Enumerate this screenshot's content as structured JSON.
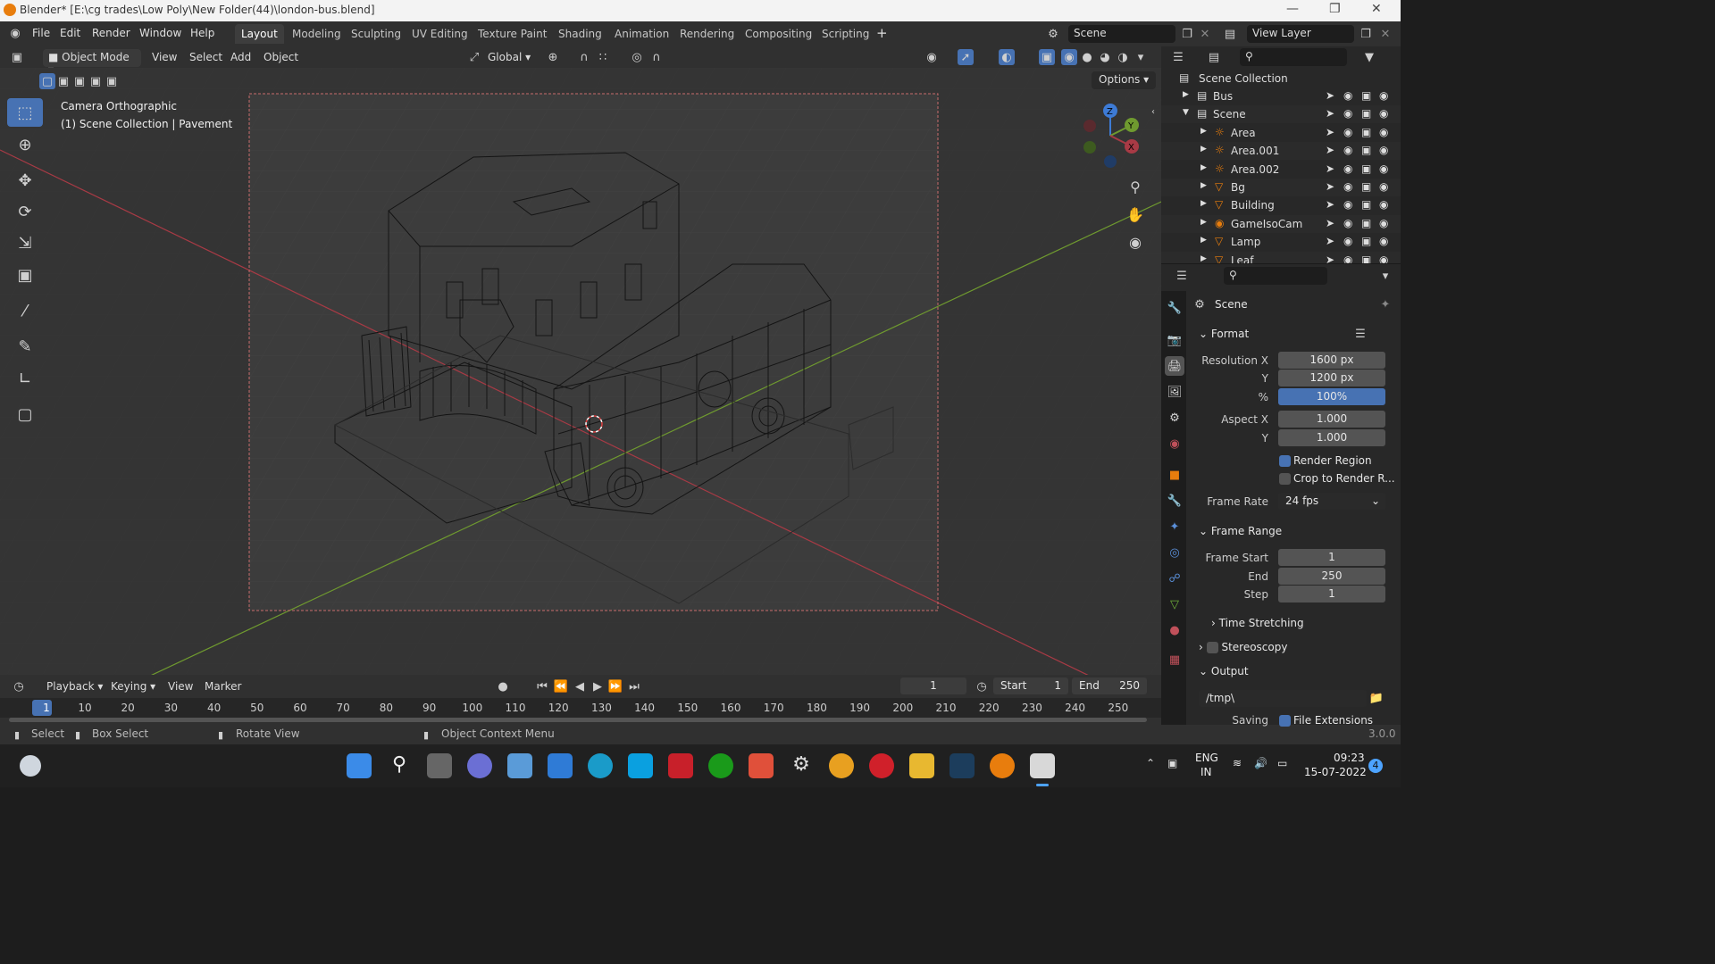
{
  "window": {
    "title": "Blender* [E:\\cg trades\\Low Poly\\New Folder(44)\\london-bus.blend]"
  },
  "menubar": {
    "menus": [
      "File",
      "Edit",
      "Render",
      "Window",
      "Help"
    ],
    "workspaces": [
      "Layout",
      "Modeling",
      "Sculpting",
      "UV Editing",
      "Texture Paint",
      "Shading",
      "Animation",
      "Rendering",
      "Compositing",
      "Scripting"
    ],
    "active_workspace": "Layout",
    "add_tab": "+",
    "scene": "Scene",
    "view_layer": "View Layer"
  },
  "viewport_header": {
    "mode": "Object Mode",
    "menus": [
      "View",
      "Select",
      "Add",
      "Object"
    ],
    "transform_orientation": "Global",
    "options": "Options"
  },
  "viewport": {
    "camera_label": "Camera Orthographic",
    "collection_label": "(1) Scene Collection | Pavement",
    "gizmo_axes": [
      "Z",
      "Y",
      "X"
    ]
  },
  "timeline": {
    "menus": [
      "Playback",
      "Keying",
      "View",
      "Marker"
    ],
    "current_frame": "1",
    "start_label": "Start",
    "start": "1",
    "end_label": "End",
    "end": "250",
    "ticks": [
      "1",
      "10",
      "20",
      "30",
      "40",
      "50",
      "60",
      "70",
      "80",
      "90",
      "100",
      "110",
      "120",
      "130",
      "140",
      "150",
      "160",
      "170",
      "180",
      "190",
      "200",
      "210",
      "220",
      "230",
      "240",
      "250"
    ]
  },
  "status": {
    "select": "Select",
    "box_select": "Box Select",
    "rotate_view": "Rotate View",
    "context_menu": "Object Context Menu",
    "version": "3.0.0"
  },
  "outliner": {
    "root": "Scene Collection",
    "rows": [
      {
        "name": "Bus",
        "level": 1
      },
      {
        "name": "Scene",
        "level": 1
      },
      {
        "name": "Area",
        "level": 2
      },
      {
        "name": "Area.001",
        "level": 2
      },
      {
        "name": "Area.002",
        "level": 2
      },
      {
        "name": "Bg",
        "level": 2
      },
      {
        "name": "Building",
        "level": 2
      },
      {
        "name": "GameIsoCam",
        "level": 2
      },
      {
        "name": "Lamp",
        "level": 2
      },
      {
        "name": "Leaf",
        "level": 2
      }
    ]
  },
  "properties": {
    "context": "Scene",
    "format": {
      "title": "Format",
      "res_x_label": "Resolution X",
      "res_x": "1600 px",
      "res_y_label": "Y",
      "res_y": "1200 px",
      "pct_label": "%",
      "pct": "100%",
      "aspect_x_label": "Aspect X",
      "aspect_x": "1.000",
      "aspect_y_label": "Y",
      "aspect_y": "1.000",
      "render_region": "Render Region",
      "crop_label": "Crop to Render R...",
      "frame_rate_label": "Frame Rate",
      "frame_rate": "24 fps"
    },
    "frame_range": {
      "title": "Frame Range",
      "start_label": "Frame Start",
      "start": "1",
      "end_label": "End",
      "end": "250",
      "step_label": "Step",
      "step": "1"
    },
    "time_stretching": "Time Stretching",
    "stereoscopy": "Stereoscopy",
    "output": {
      "title": "Output",
      "path": "/tmp\\",
      "saving_label": "Saving",
      "file_extensions": "File Extensions"
    }
  },
  "taskbar": {
    "lang": "ENG",
    "region": "IN",
    "time": "09:23",
    "date": "15-07-2022",
    "notif": "4"
  },
  "colors": {
    "accent": "#4772b3",
    "x_axis": "#a83a45",
    "y_axis": "#6f9a2f",
    "z_axis": "#3d7bd6"
  }
}
